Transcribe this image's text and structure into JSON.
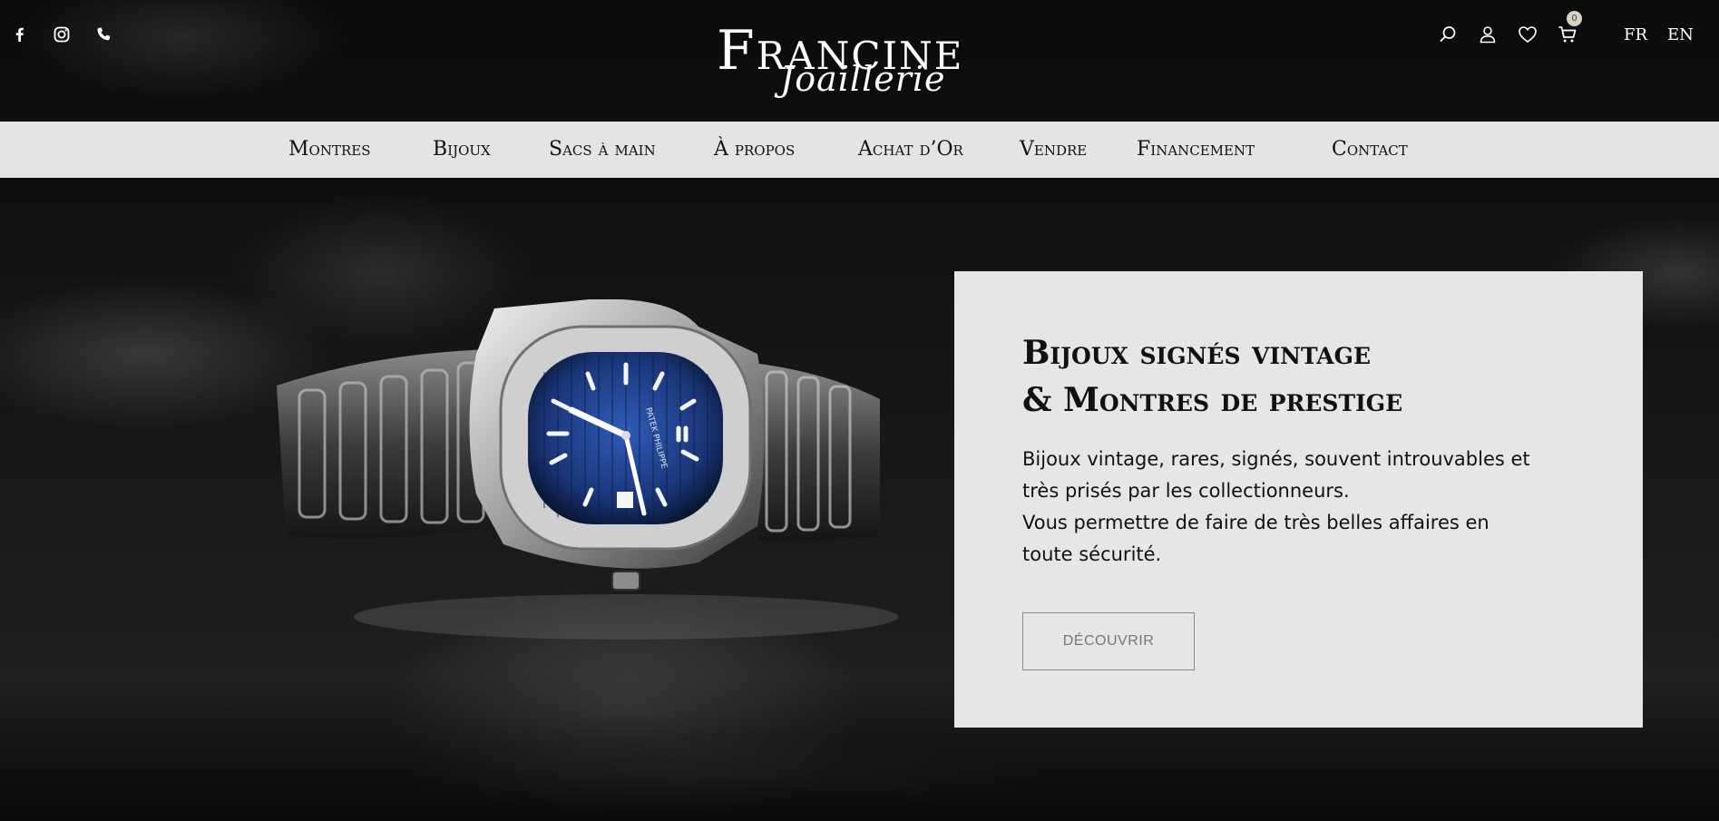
{
  "brand": {
    "name": "Francine",
    "subname": "Joaillerie"
  },
  "social_icons": [
    "facebook-icon",
    "instagram-icon",
    "phone-icon"
  ],
  "tools": {
    "icons": [
      "search-icon",
      "user-icon",
      "heart-icon",
      "cart-icon"
    ],
    "cart_count": "0"
  },
  "languages": [
    "FR",
    "EN"
  ],
  "nav": {
    "items": [
      "Montres",
      "Bijoux",
      "Sacs à main",
      "À propos",
      "Achat d’Or",
      "Vendre",
      "Financement",
      "Contact"
    ]
  },
  "hero": {
    "title_line1": "Bijoux signés vintage",
    "title_line2": "& Montres de prestige",
    "text_line1": "Bijoux vintage, rares, signés, souvent introuvables et",
    "text_line2": "très prisés par les collectionneurs.",
    "text_line3": "Vous permettre de faire de très belles affaires en",
    "text_line4": "toute sécurité.",
    "button_label": "DÉCOUVRIR",
    "watch_dial_text": "PATEK PHILIPPE"
  },
  "colors": {
    "nav_bg": "#e4e4e4",
    "card_bg": "#e6e6e6",
    "dial_blue": "#1f3f86"
  }
}
